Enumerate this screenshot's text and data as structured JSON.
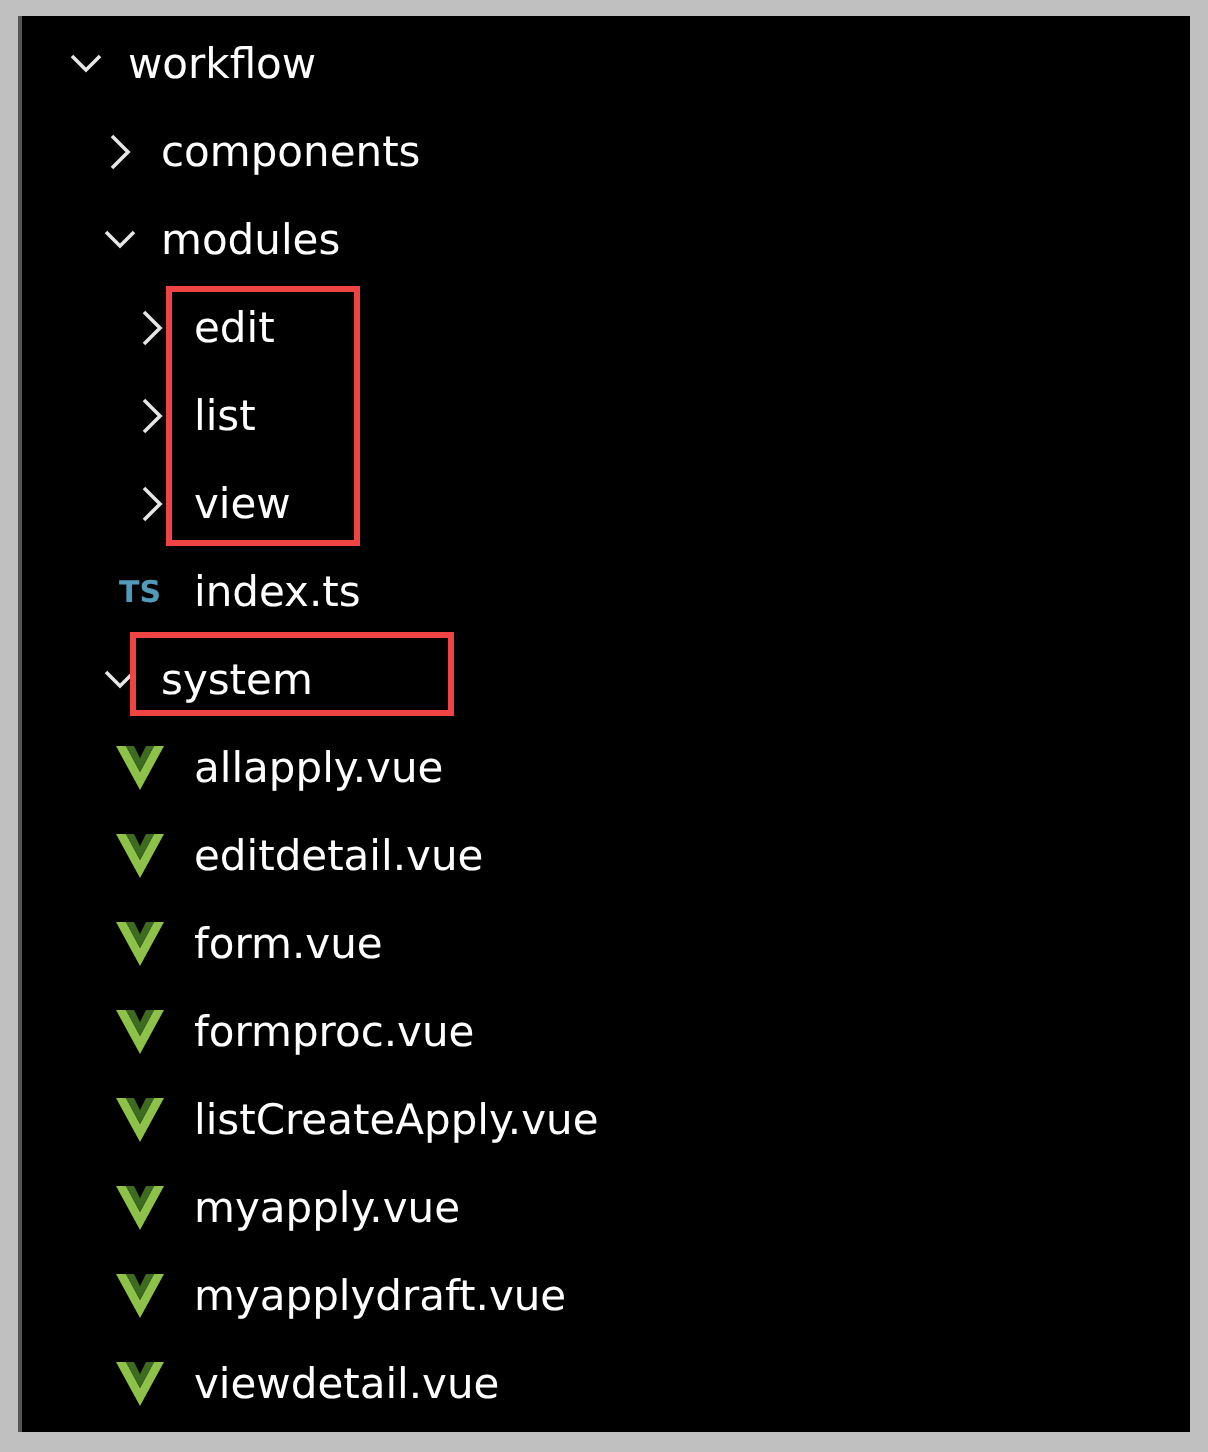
{
  "tree": [
    {
      "label": "workflow",
      "kind": "folder",
      "expanded": true,
      "highlighted": false,
      "children": [
        {
          "label": "components",
          "kind": "folder",
          "expanded": false,
          "highlighted": false
        },
        {
          "label": "modules",
          "kind": "folder",
          "expanded": true,
          "highlighted": false,
          "children": [
            {
              "label": "edit",
              "kind": "folder",
              "expanded": false,
              "highlighted": true
            },
            {
              "label": "list",
              "kind": "folder",
              "expanded": false,
              "highlighted": true
            },
            {
              "label": "view",
              "kind": "folder",
              "expanded": false,
              "highlighted": true
            },
            {
              "label": "index.ts",
              "kind": "ts",
              "icon_text": "TS",
              "highlighted": false
            }
          ]
        },
        {
          "label": "system",
          "kind": "folder",
          "expanded": true,
          "highlighted": true,
          "children": [
            {
              "label": "allapply.vue",
              "kind": "vue",
              "highlighted": false
            },
            {
              "label": "editdetail.vue",
              "kind": "vue",
              "highlighted": false
            },
            {
              "label": "form.vue",
              "kind": "vue",
              "highlighted": false
            },
            {
              "label": "formproc.vue",
              "kind": "vue",
              "highlighted": false
            },
            {
              "label": "listCreateApply.vue",
              "kind": "vue",
              "highlighted": false
            },
            {
              "label": "myapply.vue",
              "kind": "vue",
              "highlighted": false
            },
            {
              "label": "myapplydraft.vue",
              "kind": "vue",
              "highlighted": false
            },
            {
              "label": "viewdetail.vue",
              "kind": "vue",
              "highlighted": false
            }
          ]
        }
      ]
    }
  ]
}
